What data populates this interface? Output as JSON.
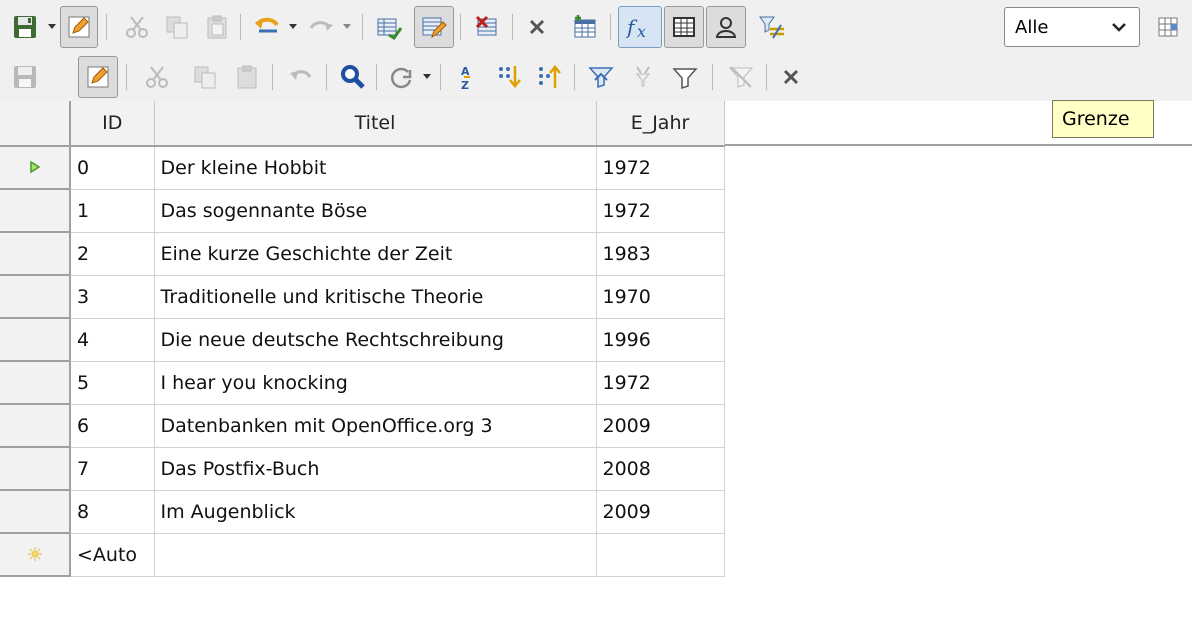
{
  "toolbar_top": {
    "items": [
      "save-icon",
      "dropdown-arrow-icon",
      "edit-icon",
      "cut-icon",
      "copy-icon",
      "paste-icon",
      "undo-icon",
      "undo-dropdown-icon",
      "redo-icon",
      "redo-dropdown-icon",
      "new-record-icon",
      "record-edit-icon",
      "delete-record-icon",
      "close-icon",
      "insert-field-icon",
      "formula-icon",
      "table-icon",
      "person-icon",
      "not-equal-filter-icon",
      "grid-icon"
    ],
    "combo_value": "Alle"
  },
  "tooltip": "Grenze",
  "table": {
    "columns": [
      "ID",
      "Titel",
      "E_Jahr"
    ],
    "rows": [
      {
        "id": "0",
        "titel": "Der kleine Hobbit",
        "jahr": "1972"
      },
      {
        "id": "1",
        "titel": "Das sogennante Böse",
        "jahr": "1972"
      },
      {
        "id": "2",
        "titel": "Eine kurze Geschichte der Zeit",
        "jahr": "1983"
      },
      {
        "id": "3",
        "titel": "Traditionelle und kritische Theorie",
        "jahr": "1970"
      },
      {
        "id": "4",
        "titel": "Die neue deutsche Rechtschreibung",
        "jahr": "1996"
      },
      {
        "id": "5",
        "titel": "I hear you knocking",
        "jahr": "1972"
      },
      {
        "id": "6",
        "titel": "Datenbanken mit OpenOffice.org 3",
        "jahr": "2009"
      },
      {
        "id": "7",
        "titel": "Das Postfix-Buch",
        "jahr": "2008"
      },
      {
        "id": "8",
        "titel": "Im Augenblick",
        "jahr": "2009"
      }
    ],
    "new_row_id": "<Auto"
  },
  "colors": {
    "accent_green": "#4c9a2a",
    "new_row_yellow": "#e6c34a",
    "tooltip_bg": "#ffffc6"
  }
}
